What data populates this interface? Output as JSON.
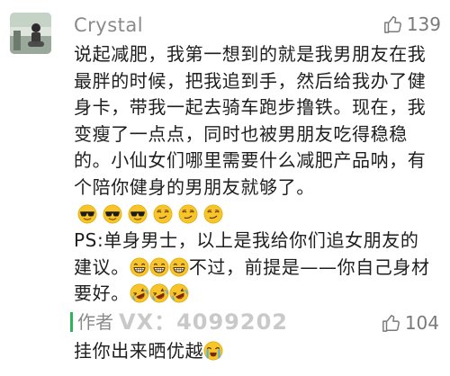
{
  "comment": {
    "username": "Crystal",
    "like_count": "139",
    "text_part1": "说起减肥，我第一想到的就是我男朋友在我最胖的时候，把我追到手，然后给我办了健身卡，带我一起去骑车跑步撸铁。现在，我变瘦了一点点，同时也被男朋友吃得稳稳的。小仙女们哪里需要什么减肥产品呐，有个陪你健身的男朋友就够了。",
    "emojis_row1": [
      "sunglasses-emoji",
      "sunglasses-emoji",
      "sunglasses-emoji",
      "smirk-emoji",
      "smirk-emoji",
      "smirk-emoji"
    ],
    "text_part2": "PS:单身男士，以上是我给你们追女朋友的建议。",
    "emojis_row2": [
      "grin-emoji",
      "grin-emoji",
      "grin-emoji"
    ],
    "text_part3": "不过，前提是——你自己身材要好。",
    "emojis_row3": [
      "rofl-emoji",
      "rofl-emoji",
      "rofl-emoji"
    ]
  },
  "reply": {
    "author_tag": "作者",
    "watermark": "VX：4099202",
    "like_count": "104",
    "text": "挂你出来晒优越",
    "emoji": "crying-emoji"
  },
  "colors": {
    "author_bar": "#2fb45a",
    "secondary_text": "#8a8a8a",
    "emoji_face": "#f7c52b"
  }
}
